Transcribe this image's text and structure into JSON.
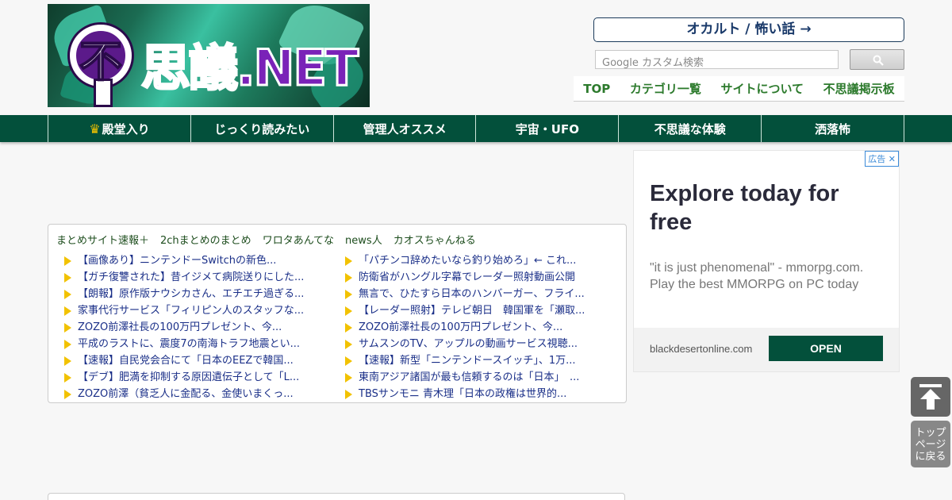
{
  "header": {
    "logo_text": "不思議.NET",
    "occult_button": "オカルト / 怖い話 →",
    "search_placeholder": "Google カスタム検索",
    "search_icon": "search-icon",
    "top_nav": [
      "TOP",
      "カテゴリ一覧",
      "サイトについて",
      "不思議掲示板"
    ]
  },
  "navbar": {
    "items": [
      "殿堂入り",
      "じっくり読みたい",
      "管理人オススメ",
      "宇宙・UFO",
      "不思議な体験",
      "洒落怖"
    ],
    "crown_icon": "crown-icon"
  },
  "links": {
    "sites": [
      "まとめサイト速報＋",
      "2chまとめのまとめ",
      "ワロタあんてな",
      "news人",
      "カオスちゃんねる"
    ],
    "left": [
      "【画像あり】ニンテンドーSwitchの新色...",
      "【ガチ復讐された】昔イジメて病院送りにした...",
      "【朗報】原作版ナウシカさん、エチエチ過ぎる...",
      "家事代行サービス「フィリピン人のスタッフな...",
      "ZOZO前澤社長の100万円プレゼント、今...",
      "平成のラストに、震度7の南海トラフ地震とい...",
      "【速報】自民党会合にて「日本のEEZで韓国...",
      "【デブ】肥満を抑制する原因遺伝子として「L...",
      "ZOZO前澤（貧乏人に金配る、金使いまくっ..."
    ],
    "right": [
      "「パチンコ辞めたいなら釣り始めろ」← これ...",
      "防衛省がハングル字幕でレーダー照射動画公開",
      "無言で、ひたすら日本のハンバーガー、フライ...",
      "【レーダー照射】テレビ朝日　韓国軍を「瀬取...",
      "ZOZO前澤社長の100万円プレゼント、今...",
      "サムスンのTV、アップルの動画サービス視聴...",
      "【速報】新型「ニンテンドースイッチ」、1万...",
      "東南アジア諸国が最も信頼するのは「日本」　...",
      "TBSサンモニ 青木理「日本の政権は世界的..."
    ]
  },
  "ad": {
    "badge": "広告 ✕",
    "headline": "Explore today for free",
    "body": "\"it is just phenomenal\" - mmorpg.com. Play the best MMORPG on PC today",
    "domain": "blackdesertonline.com",
    "cta": "OPEN"
  },
  "side": {
    "back_to_top": "トップページに戻る"
  },
  "colors": {
    "nav_green": "#03503b",
    "link_blue": "#1a2f88",
    "top_nav_green": "#2c7a2c",
    "bullet_yellow": "#f2c200"
  }
}
